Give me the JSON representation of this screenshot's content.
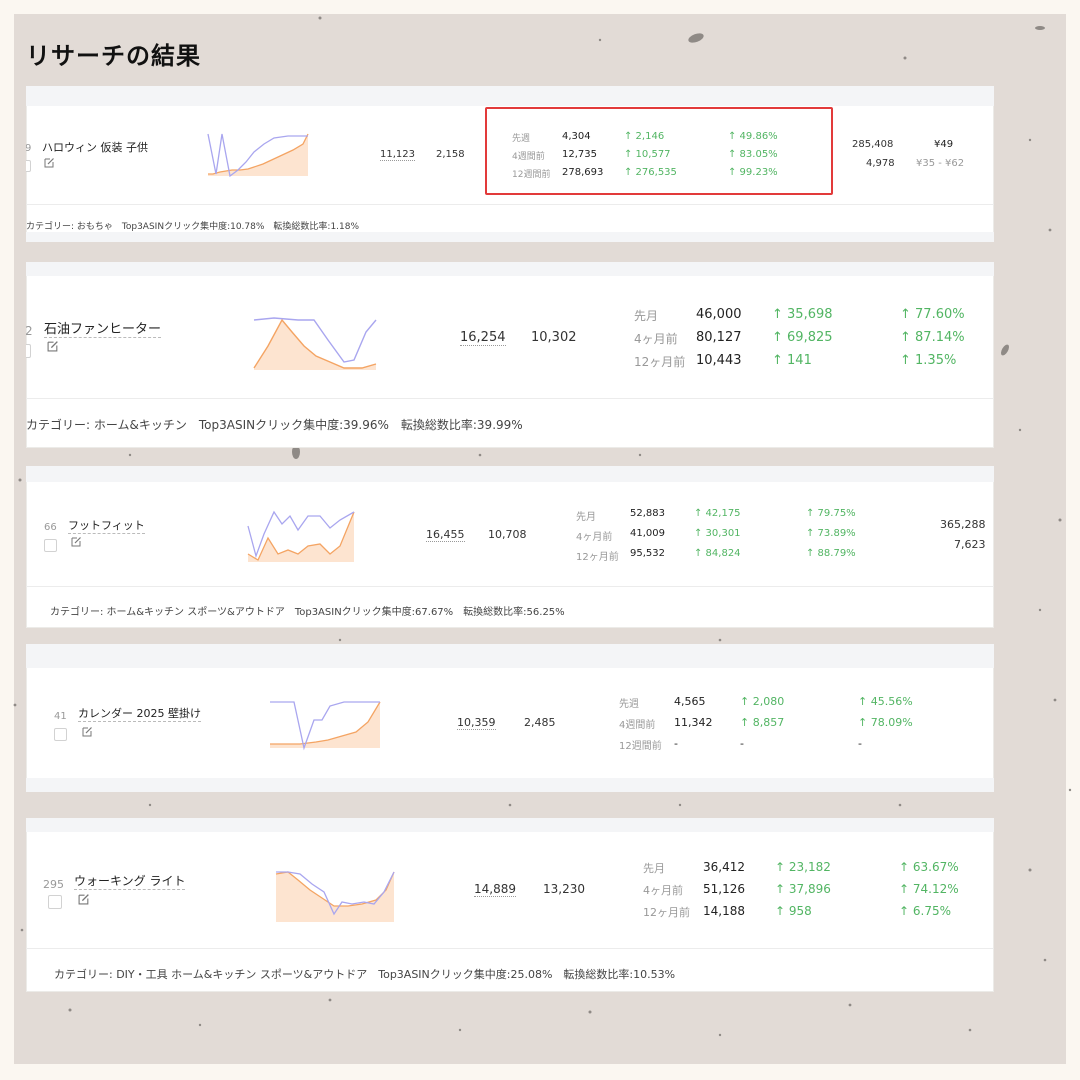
{
  "page_title": "リサーチの結果",
  "icons": {
    "edit": "edit-icon",
    "checkbox": "checkbox-icon"
  },
  "colors": {
    "background": "#e2dbd6",
    "up": "#52b563",
    "highlight": "#e23a3a",
    "sparkline_a": "#a9a6ef",
    "sparkline_b": "#f4a463"
  },
  "cards": [
    {
      "rank": "9",
      "keyword": "ハロウィン 仮装 子供",
      "col1": "11,123",
      "col2": "2,158",
      "stats": [
        {
          "label": "先週",
          "value": "4,304",
          "delta": "↑ 2,146",
          "pct": "↑ 49.86%"
        },
        {
          "label": "4週間前",
          "value": "12,735",
          "delta": "↑ 10,577",
          "pct": "↑ 83.05%"
        },
        {
          "label": "12週間前",
          "value": "278,693",
          "delta": "↑ 276,535",
          "pct": "↑ 99.23%"
        }
      ],
      "extra": {
        "top": "285,408",
        "bottom": "4,978",
        "price": "¥49",
        "price_range": "¥35 - ¥62"
      },
      "category": "カテゴリー: おもちゃ　Top3ASINクリック集中度:10.78%　転換総数比率:1.18%"
    },
    {
      "rank": "2",
      "keyword": "石油ファンヒーター",
      "col1": "16,254",
      "col2": "10,302",
      "stats": [
        {
          "label": "先月",
          "value": "46,000",
          "delta": "↑ 35,698",
          "pct": "↑ 77.60%"
        },
        {
          "label": "4ヶ月前",
          "value": "80,127",
          "delta": "↑ 69,825",
          "pct": "↑ 87.14%"
        },
        {
          "label": "12ヶ月前",
          "value": "10,443",
          "delta": "↑ 141",
          "pct": "↑ 1.35%"
        }
      ],
      "category": "カテゴリー: ホーム&キッチン　Top3ASINクリック集中度:39.96%　転換総数比率:39.99%"
    },
    {
      "rank": "66",
      "keyword": "フットフィット",
      "col1": "16,455",
      "col2": "10,708",
      "stats": [
        {
          "label": "先月",
          "value": "52,883",
          "delta": "↑ 42,175",
          "pct": "↑ 79.75%"
        },
        {
          "label": "4ヶ月前",
          "value": "41,009",
          "delta": "↑ 30,301",
          "pct": "↑ 73.89%"
        },
        {
          "label": "12ヶ月前",
          "value": "95,532",
          "delta": "↑ 84,824",
          "pct": "↑ 88.79%"
        }
      ],
      "extra": {
        "top": "365,288",
        "bottom": "7,623"
      },
      "category": "カテゴリー: ホーム&キッチン スポーツ&アウトドア　Top3ASINクリック集中度:67.67%　転換総数比率:56.25%"
    },
    {
      "rank": "41",
      "keyword": "カレンダー 2025 壁掛け",
      "col1": "10,359",
      "col2": "2,485",
      "stats": [
        {
          "label": "先週",
          "value": "4,565",
          "delta": "↑ 2,080",
          "pct": "↑ 45.56%"
        },
        {
          "label": "4週間前",
          "value": "11,342",
          "delta": "↑ 8,857",
          "pct": "↑ 78.09%"
        },
        {
          "label": "12週間前",
          "value": "-",
          "delta": "-",
          "pct": "-"
        }
      ]
    },
    {
      "rank": "295",
      "keyword": "ウォーキング ライト",
      "col1": "14,889",
      "col2": "13,230",
      "stats": [
        {
          "label": "先月",
          "value": "36,412",
          "delta": "↑ 23,182",
          "pct": "↑ 63.67%"
        },
        {
          "label": "4ヶ月前",
          "value": "51,126",
          "delta": "↑ 37,896",
          "pct": "↑ 74.12%"
        },
        {
          "label": "12ヶ月前",
          "value": "14,188",
          "delta": "↑ 958",
          "pct": "↑ 6.75%"
        }
      ],
      "category": "カテゴリー: DIY・工具 ホーム&キッチン スポーツ&アウトドア　Top3ASINクリック集中度:25.08%　転換総数比率:10.53%"
    }
  ]
}
